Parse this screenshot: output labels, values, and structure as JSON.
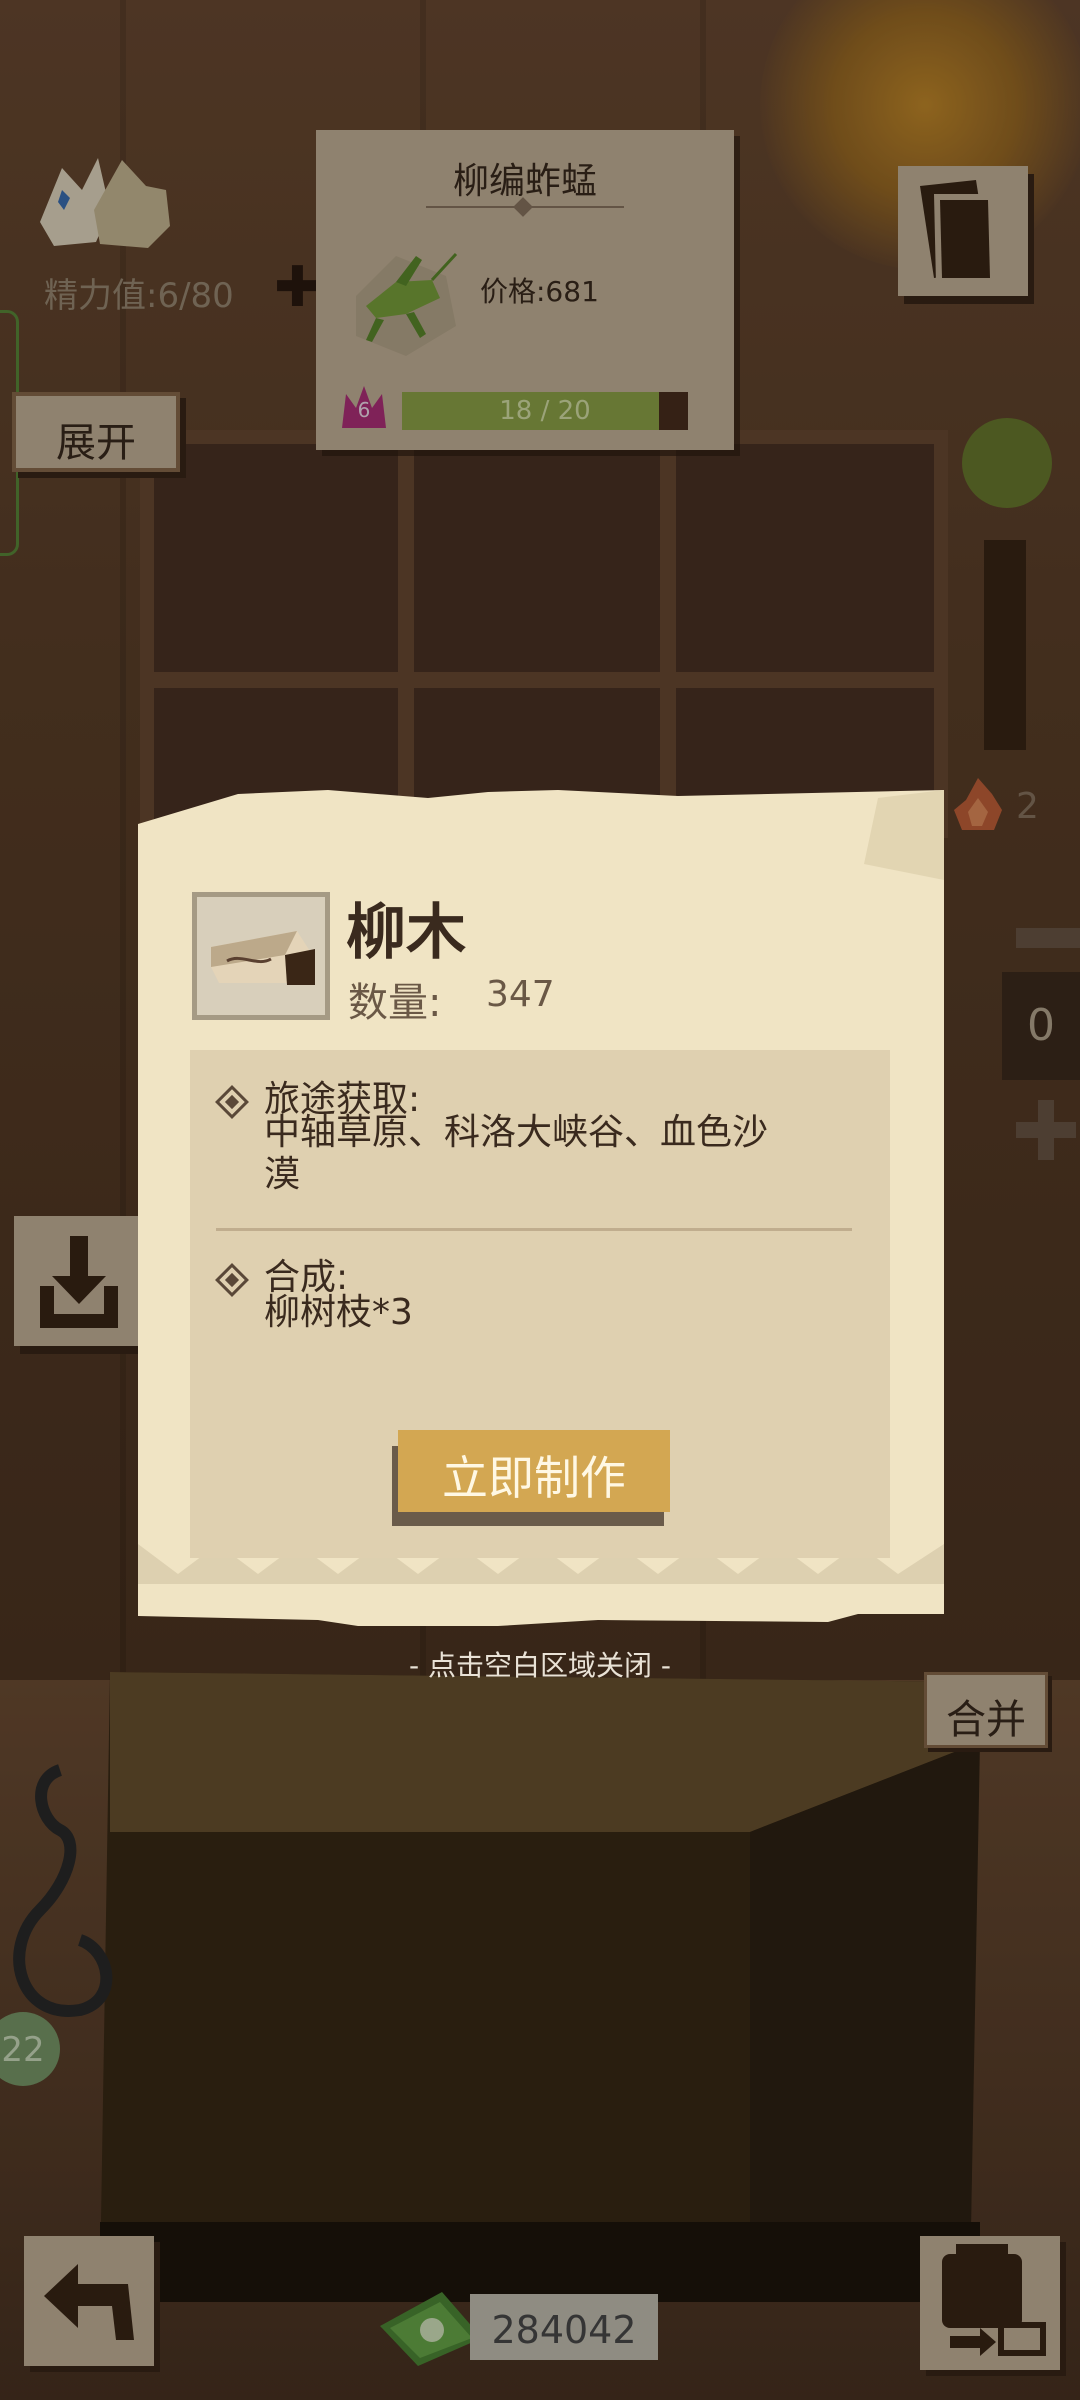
{
  "hud": {
    "energy_label": "精力值:6/80",
    "expand_label": "展开",
    "flame_count": "2",
    "counter_value": "0",
    "merge_label": "合并",
    "bag_count": "22",
    "money": "284042"
  },
  "item_card": {
    "title": "柳编蚱蜢",
    "price": "价格:681",
    "level": "6",
    "progress_text": "18 / 20",
    "progress_fraction": 0.9
  },
  "detail": {
    "name": "柳木",
    "qty_label": "数量:",
    "qty_value": "347",
    "source_title": "旅途获取:",
    "source_line1": "中轴草原、科洛大峡谷、血色沙",
    "source_line2": "漠",
    "craft_title": "合成:",
    "craft_recipe": "柳树枝*3",
    "make_button": "立即制作"
  },
  "close_hint": "- 点击空白区域关闭 -",
  "colors": {
    "paper": "#f0e4c4",
    "panel": "#dfd0b0",
    "button_gold": "#d3a752",
    "progress_green": "#8fa648",
    "level_pink": "#b0307a"
  }
}
